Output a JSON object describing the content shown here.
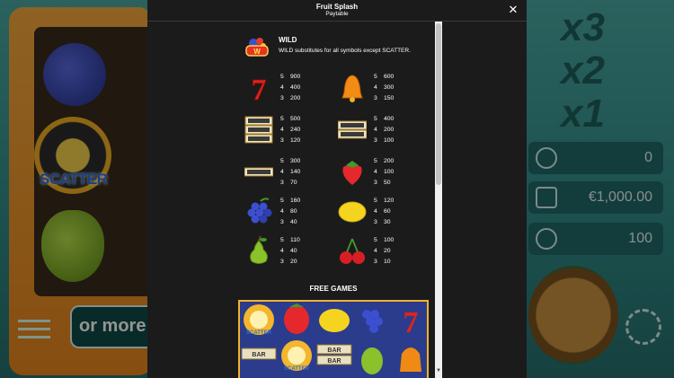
{
  "background": {
    "reels": {
      "scatter_label": "SCATTER"
    },
    "button_label": "or more",
    "multipliers": [
      "x3",
      "x2",
      "x1"
    ],
    "stats": [
      {
        "icon": "w-badge-icon",
        "value": "0"
      },
      {
        "icon": "wallet-icon",
        "value": "€1,000.00"
      },
      {
        "icon": "coin-dollar-icon",
        "value": "100"
      }
    ]
  },
  "modal": {
    "title": "Fruit Splash",
    "subtitle": "Paytable",
    "close_label": "✕",
    "wild": {
      "title": "WILD",
      "description": "WILD substitutes for all symbols except SCATTER.",
      "icon": "wild-icon"
    },
    "paytable": [
      {
        "symbol": "seven-icon",
        "pays": [
          {
            "n": "5",
            "v": "900"
          },
          {
            "n": "4",
            "v": "400"
          },
          {
            "n": "3",
            "v": "200"
          }
        ]
      },
      {
        "symbol": "bell-icon",
        "pays": [
          {
            "n": "5",
            "v": "600"
          },
          {
            "n": "4",
            "v": "300"
          },
          {
            "n": "3",
            "v": "150"
          }
        ]
      },
      {
        "symbol": "triple-bar-icon",
        "pays": [
          {
            "n": "5",
            "v": "500"
          },
          {
            "n": "4",
            "v": "240"
          },
          {
            "n": "3",
            "v": "120"
          }
        ]
      },
      {
        "symbol": "double-bar-icon",
        "pays": [
          {
            "n": "5",
            "v": "400"
          },
          {
            "n": "4",
            "v": "200"
          },
          {
            "n": "3",
            "v": "100"
          }
        ]
      },
      {
        "symbol": "single-bar-icon",
        "pays": [
          {
            "n": "5",
            "v": "300"
          },
          {
            "n": "4",
            "v": "140"
          },
          {
            "n": "3",
            "v": "70"
          }
        ]
      },
      {
        "symbol": "strawberry-icon",
        "pays": [
          {
            "n": "5",
            "v": "200"
          },
          {
            "n": "4",
            "v": "100"
          },
          {
            "n": "3",
            "v": "50"
          }
        ]
      },
      {
        "symbol": "grapes-icon",
        "pays": [
          {
            "n": "5",
            "v": "160"
          },
          {
            "n": "4",
            "v": "80"
          },
          {
            "n": "3",
            "v": "40"
          }
        ]
      },
      {
        "symbol": "lemon-icon",
        "pays": [
          {
            "n": "5",
            "v": "120"
          },
          {
            "n": "4",
            "v": "60"
          },
          {
            "n": "3",
            "v": "30"
          }
        ]
      },
      {
        "symbol": "pear-icon",
        "pays": [
          {
            "n": "5",
            "v": "110"
          },
          {
            "n": "4",
            "v": "40"
          },
          {
            "n": "3",
            "v": "20"
          }
        ]
      },
      {
        "symbol": "cherries-icon",
        "pays": [
          {
            "n": "5",
            "v": "100"
          },
          {
            "n": "4",
            "v": "20"
          },
          {
            "n": "3",
            "v": "10"
          }
        ]
      }
    ],
    "free_games": {
      "heading": "FREE GAMES",
      "scatter_label": "SCATTER",
      "bar_label": "BAR"
    }
  }
}
